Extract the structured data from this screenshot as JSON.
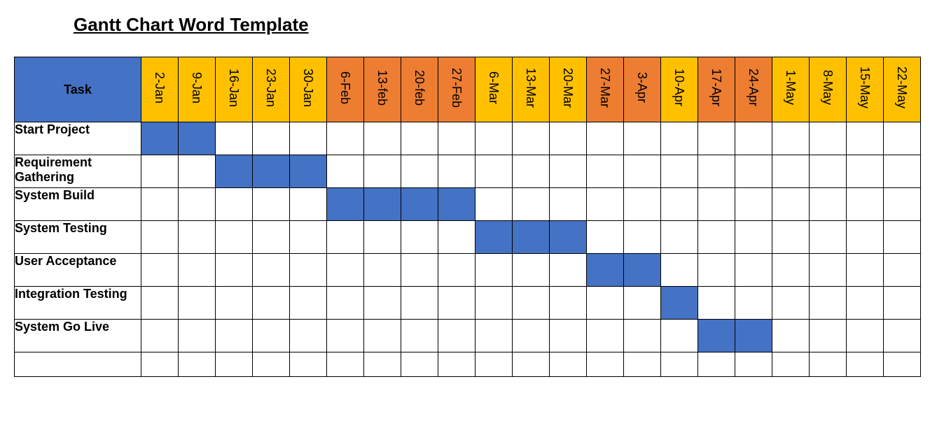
{
  "title": "Gantt Chart Word Template",
  "task_header": "Task",
  "colors": {
    "task_header_bg": "#4472c4",
    "bar_fill": "#4472c4",
    "month_amber": "#ffc000",
    "month_orange": "#ed7d31"
  },
  "dates": [
    {
      "label": "2-Jan",
      "color": "amber"
    },
    {
      "label": "9-Jan",
      "color": "amber"
    },
    {
      "label": "16-Jan",
      "color": "amber"
    },
    {
      "label": "23-Jan",
      "color": "amber"
    },
    {
      "label": "30-Jan",
      "color": "amber"
    },
    {
      "label": "6-Feb",
      "color": "orange"
    },
    {
      "label": "13-feb",
      "color": "orange"
    },
    {
      "label": "20-feb",
      "color": "orange"
    },
    {
      "label": "27-Feb",
      "color": "orange"
    },
    {
      "label": "6-Mar",
      "color": "amber"
    },
    {
      "label": "13-Mar",
      "color": "amber"
    },
    {
      "label": "20-Mar",
      "color": "amber"
    },
    {
      "label": "27-Mar",
      "color": "orange"
    },
    {
      "label": "3-Apr",
      "color": "orange"
    },
    {
      "label": "10-Apr",
      "color": "amber"
    },
    {
      "label": "17-Apr",
      "color": "orange"
    },
    {
      "label": "24-Apr",
      "color": "orange"
    },
    {
      "label": "1-May",
      "color": "amber"
    },
    {
      "label": "8-May",
      "color": "amber"
    },
    {
      "label": "15-May",
      "color": "amber"
    },
    {
      "label": "22-May",
      "color": "amber"
    }
  ],
  "tasks": [
    {
      "name": "Start Project",
      "start": 0,
      "span": 2
    },
    {
      "name": "Requirement Gathering",
      "start": 2,
      "span": 3
    },
    {
      "name": "System Build",
      "start": 5,
      "span": 4
    },
    {
      "name": "System Testing",
      "start": 9,
      "span": 3
    },
    {
      "name": "User Acceptance",
      "start": 12,
      "span": 2
    },
    {
      "name": "Integration Testing",
      "start": 14,
      "span": 1
    },
    {
      "name": "System Go Live",
      "start": 15,
      "span": 2
    }
  ],
  "trailing_empty_rows": 1,
  "chart_data": {
    "type": "bar",
    "orientation": "horizontal-gantt",
    "title": "Gantt Chart Word Template",
    "x_categories": [
      "2-Jan",
      "9-Jan",
      "16-Jan",
      "23-Jan",
      "30-Jan",
      "6-Feb",
      "13-feb",
      "20-feb",
      "27-Feb",
      "6-Mar",
      "13-Mar",
      "20-Mar",
      "27-Mar",
      "3-Apr",
      "10-Apr",
      "17-Apr",
      "24-Apr",
      "1-May",
      "8-May",
      "15-May",
      "22-May"
    ],
    "y_categories": [
      "Start Project",
      "Requirement Gathering",
      "System Build",
      "System Testing",
      "User Acceptance",
      "Integration Testing",
      "System Go Live"
    ],
    "series": [
      {
        "name": "Start Project",
        "start_index": 0,
        "duration_weeks": 2,
        "start_label": "2-Jan",
        "end_label": "9-Jan"
      },
      {
        "name": "Requirement Gathering",
        "start_index": 2,
        "duration_weeks": 3,
        "start_label": "16-Jan",
        "end_label": "30-Jan"
      },
      {
        "name": "System Build",
        "start_index": 5,
        "duration_weeks": 4,
        "start_label": "6-Feb",
        "end_label": "27-Feb"
      },
      {
        "name": "System Testing",
        "start_index": 9,
        "duration_weeks": 3,
        "start_label": "6-Mar",
        "end_label": "20-Mar"
      },
      {
        "name": "User Acceptance",
        "start_index": 12,
        "duration_weeks": 2,
        "start_label": "27-Mar",
        "end_label": "3-Apr"
      },
      {
        "name": "Integration Testing",
        "start_index": 14,
        "duration_weeks": 1,
        "start_label": "10-Apr",
        "end_label": "10-Apr"
      },
      {
        "name": "System Go Live",
        "start_index": 15,
        "duration_weeks": 2,
        "start_label": "17-Apr",
        "end_label": "24-Apr"
      }
    ]
  }
}
